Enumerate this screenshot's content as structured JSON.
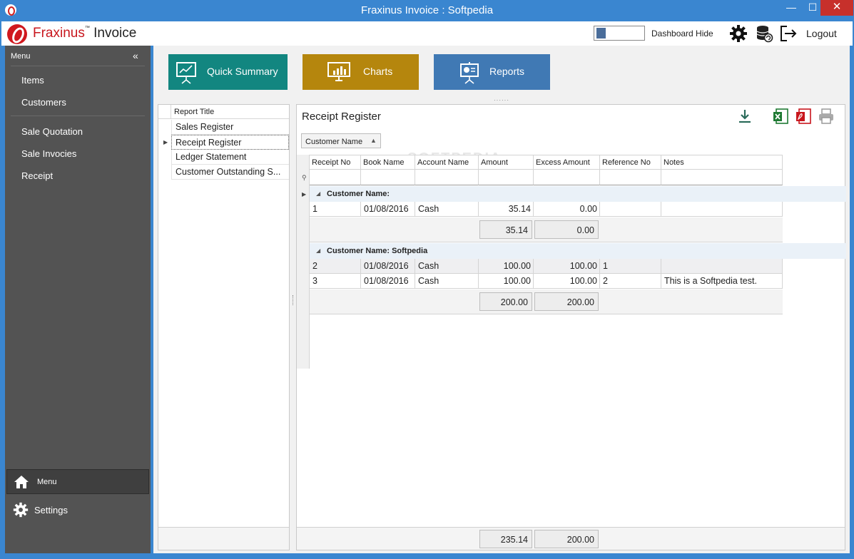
{
  "window": {
    "title": "Fraxinus Invoice : Softpedia",
    "minimize": "—",
    "maximize": "☐",
    "close": "✕"
  },
  "header": {
    "brand": "Fraxinus",
    "tm": "™",
    "product": " Invoice",
    "dashboard_label": "Dashboard Hide",
    "logout_label": "Logout"
  },
  "sidebar": {
    "title": "Menu",
    "collapse": "«",
    "items": [
      "Items",
      "Customers",
      "Sale Quotation",
      "Sale Invocies",
      "Receipt"
    ],
    "bottom_menu": "Menu",
    "bottom_settings": "Settings"
  },
  "tiles": {
    "quick_summary": "Quick Summary",
    "charts": "Charts",
    "reports": "Reports",
    "quick_color": "#128680",
    "charts_color": "#b5860d",
    "reports_color": "#4079b4"
  },
  "report_list": {
    "header": "Report Title",
    "items": [
      "Sales Register",
      "Receipt Register",
      "Ledger Statement",
      "Customer Outstanding S..."
    ],
    "selected_index": 1
  },
  "grid": {
    "title": "Receipt Register",
    "group_by": "Customer Name",
    "columns": [
      "Receipt No",
      "Book Name",
      "Account Name",
      "Amount",
      "Excess Amount",
      "Reference No",
      "Notes"
    ],
    "groups": [
      {
        "label": "Customer Name:",
        "rows": [
          [
            "1",
            "01/08/2016",
            "Cash",
            "35.14",
            "0.00",
            "",
            ""
          ]
        ],
        "sum_amount": "35.14",
        "sum_excess": "0.00"
      },
      {
        "label": "Customer Name: Softpedia",
        "rows": [
          [
            "2",
            "01/08/2016",
            "Cash",
            "100.00",
            "100.00",
            "1",
            ""
          ],
          [
            "3",
            "01/08/2016",
            "Cash",
            "100.00",
            "100.00",
            "2",
            "This is a Softpedia test."
          ]
        ],
        "sum_amount": "200.00",
        "sum_excess": "200.00"
      }
    ],
    "total_amount": "235.14",
    "total_excess": "200.00",
    "watermark": "SOFTPEDIA"
  }
}
